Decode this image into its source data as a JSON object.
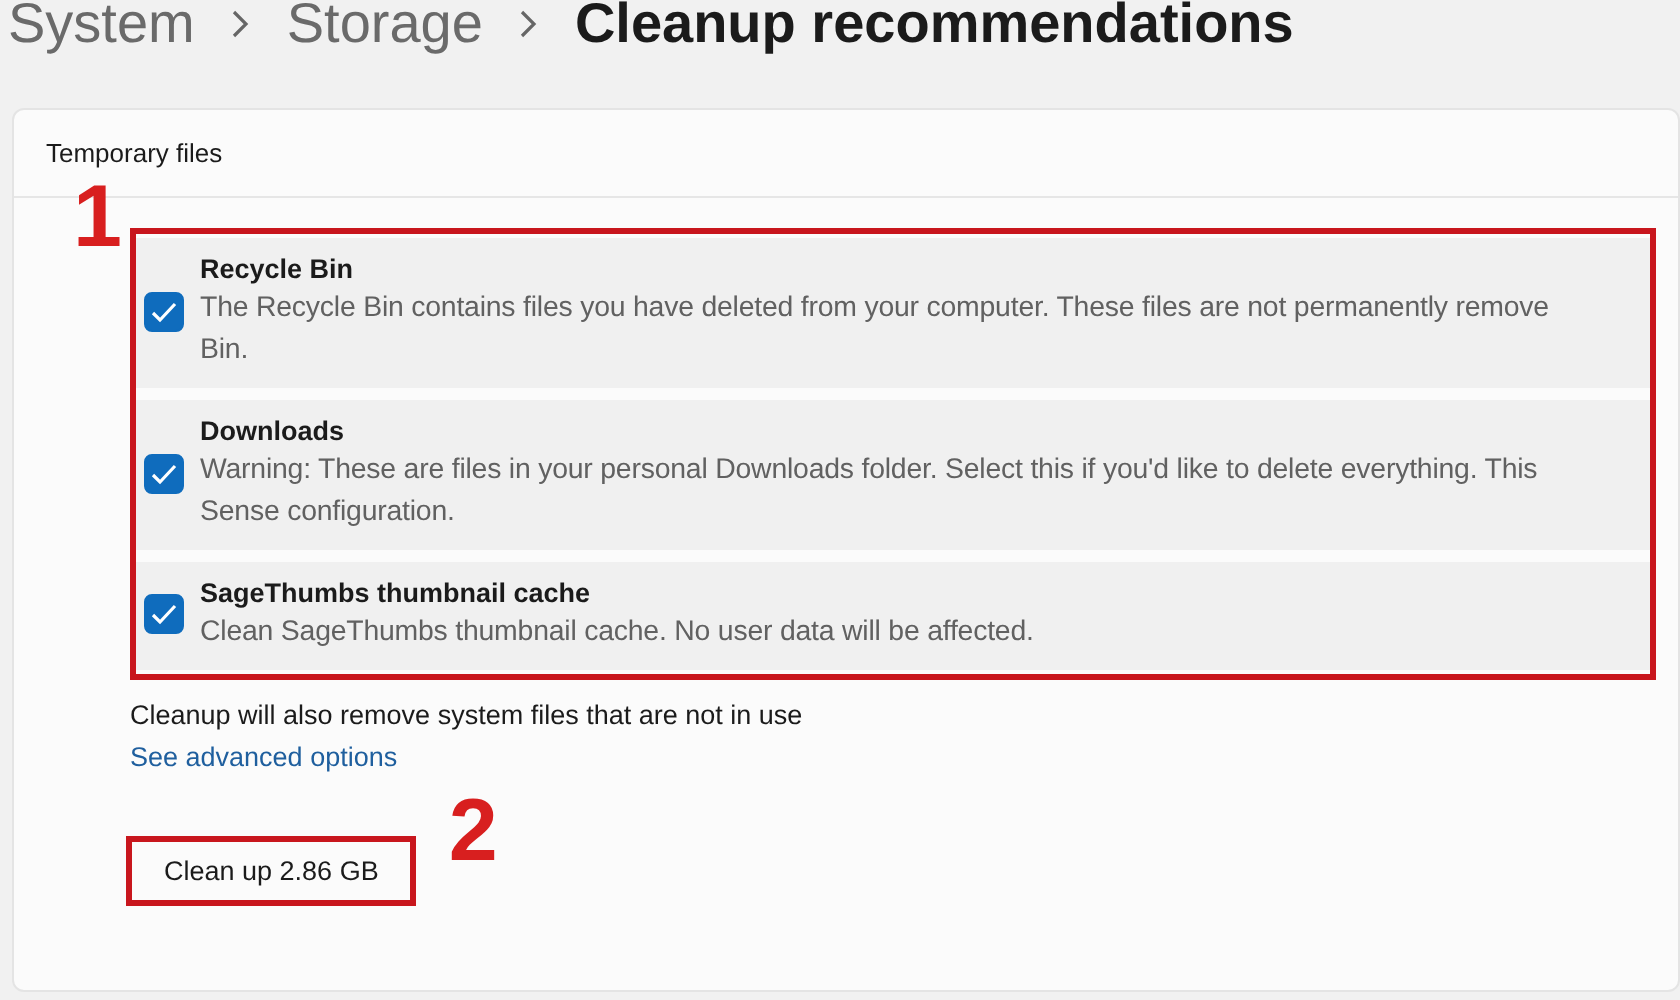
{
  "breadcrumb": [
    {
      "label": "System",
      "current": false
    },
    {
      "label": "Storage",
      "current": false
    },
    {
      "label": "Cleanup recommendations",
      "current": true
    }
  ],
  "section": {
    "title": "Temporary files"
  },
  "annotations": [
    {
      "label": "1"
    },
    {
      "label": "2"
    }
  ],
  "items": [
    {
      "title": "Recycle Bin",
      "checked": true,
      "lines": [
        "The Recycle Bin contains files you have deleted from your computer. These files are not permanently remove",
        "Bin."
      ]
    },
    {
      "title": "Downloads",
      "checked": true,
      "lines": [
        "Warning: These are files in your personal Downloads folder. Select this if you'd like to delete everything. This",
        "Sense configuration."
      ]
    },
    {
      "title": "SageThumbs thumbnail cache",
      "checked": true,
      "lines": [
        "Clean SageThumbs thumbnail cache. No user data will be affected."
      ]
    }
  ],
  "note": "Cleanup will also remove system files that are not in use",
  "link": "See advanced options",
  "button": "Clean up 2.86 GB"
}
